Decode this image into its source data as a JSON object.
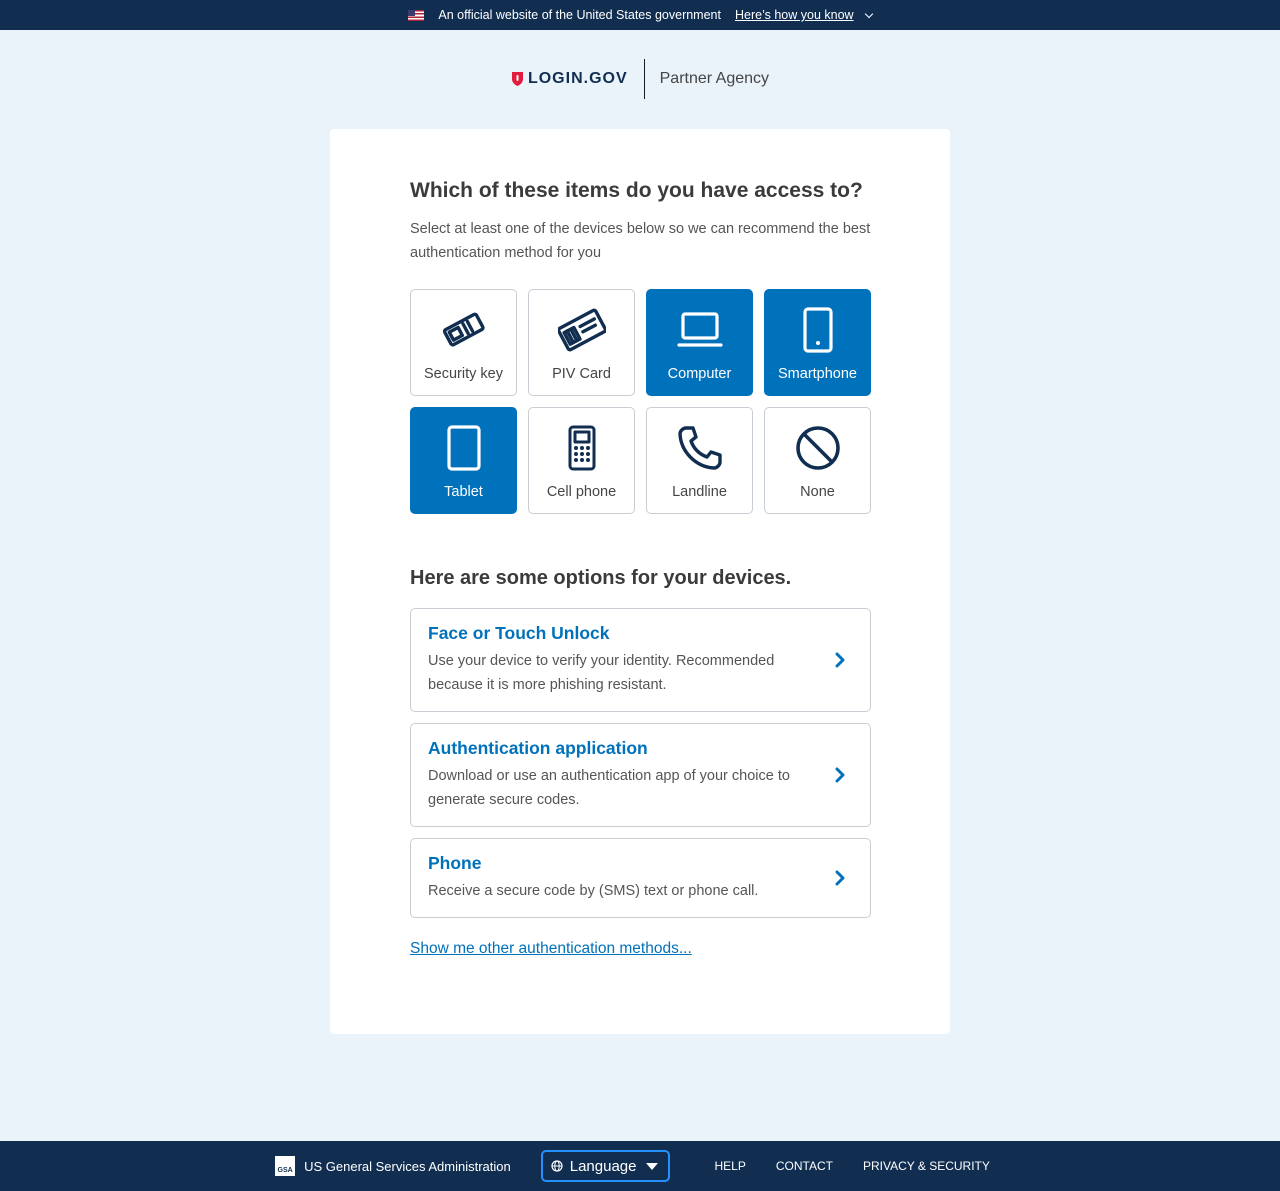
{
  "banner": {
    "official_text": "An official website of the United States government",
    "how_link": "Here’s how you know"
  },
  "header": {
    "logo_text": "LOGIN.GOV",
    "partner": "Partner Agency"
  },
  "main": {
    "title": "Which of these items do you have access to?",
    "subtitle": "Select at least one of the devices below so we can recommend the best authentication method for you",
    "devices": [
      {
        "label": "Security key",
        "icon": "security-key-icon",
        "selected": false
      },
      {
        "label": "PIV Card",
        "icon": "piv-card-icon",
        "selected": false
      },
      {
        "label": "Computer",
        "icon": "laptop-icon",
        "selected": true
      },
      {
        "label": "Smartphone",
        "icon": "smartphone-icon",
        "selected": true
      },
      {
        "label": "Tablet",
        "icon": "tablet-icon",
        "selected": true
      },
      {
        "label": "Cell phone",
        "icon": "cell-phone-icon",
        "selected": false
      },
      {
        "label": "Landline",
        "icon": "landline-phone-icon",
        "selected": false
      },
      {
        "label": "None",
        "icon": "none-prohibited-icon",
        "selected": false
      }
    ],
    "options_title": "Here are some options for your devices.",
    "options": [
      {
        "title": "Face or Touch Unlock",
        "desc": "Use your device to verify your identity. Recommended because it is more phishing resistant."
      },
      {
        "title": "Authentication application",
        "desc": "Download or use an authentication app of your choice to generate secure codes."
      },
      {
        "title": "Phone",
        "desc": "Receive a secure code by (SMS) text or phone call."
      }
    ],
    "other_link": "Show me other authentication methods..."
  },
  "footer": {
    "gsa_logo_text": "GSA",
    "agency": "US General Services Administration",
    "language": "Language",
    "links": [
      "HELP",
      "CONTACT",
      "PRIVACY & SECURITY"
    ]
  },
  "colors": {
    "navy": "#112E51",
    "primary": "#0071BB",
    "background": "#EAF2FA",
    "logo_red": "#E21C3D"
  }
}
